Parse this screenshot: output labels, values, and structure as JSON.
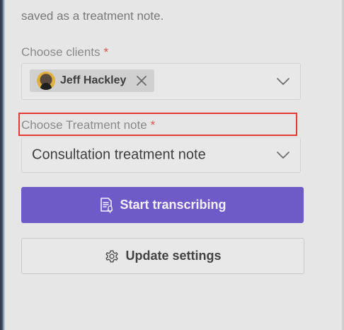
{
  "window": {
    "intro_text_line1_partial": "...",
    "intro_text_line2": "saved as a treatment note."
  },
  "clients_field": {
    "label": "Choose clients",
    "required_mark": "*",
    "selected_client": {
      "name": "Jeff Hackley",
      "avatar_icon": "user-avatar"
    },
    "chevron_icon": "chevron-down-icon",
    "remove_icon": "close-icon"
  },
  "treatment_field": {
    "label": "Choose Treatment note",
    "required_mark": "*",
    "value": "Consultation treatment note",
    "chevron_icon": "chevron-down-icon"
  },
  "actions": {
    "start_transcribing": {
      "label": "Start transcribing",
      "icon": "document-mic-icon",
      "color": "#6f5bc8"
    },
    "update_settings": {
      "label": "Update settings",
      "icon": "gear-icon"
    }
  },
  "highlight": {
    "color": "#e53935"
  }
}
